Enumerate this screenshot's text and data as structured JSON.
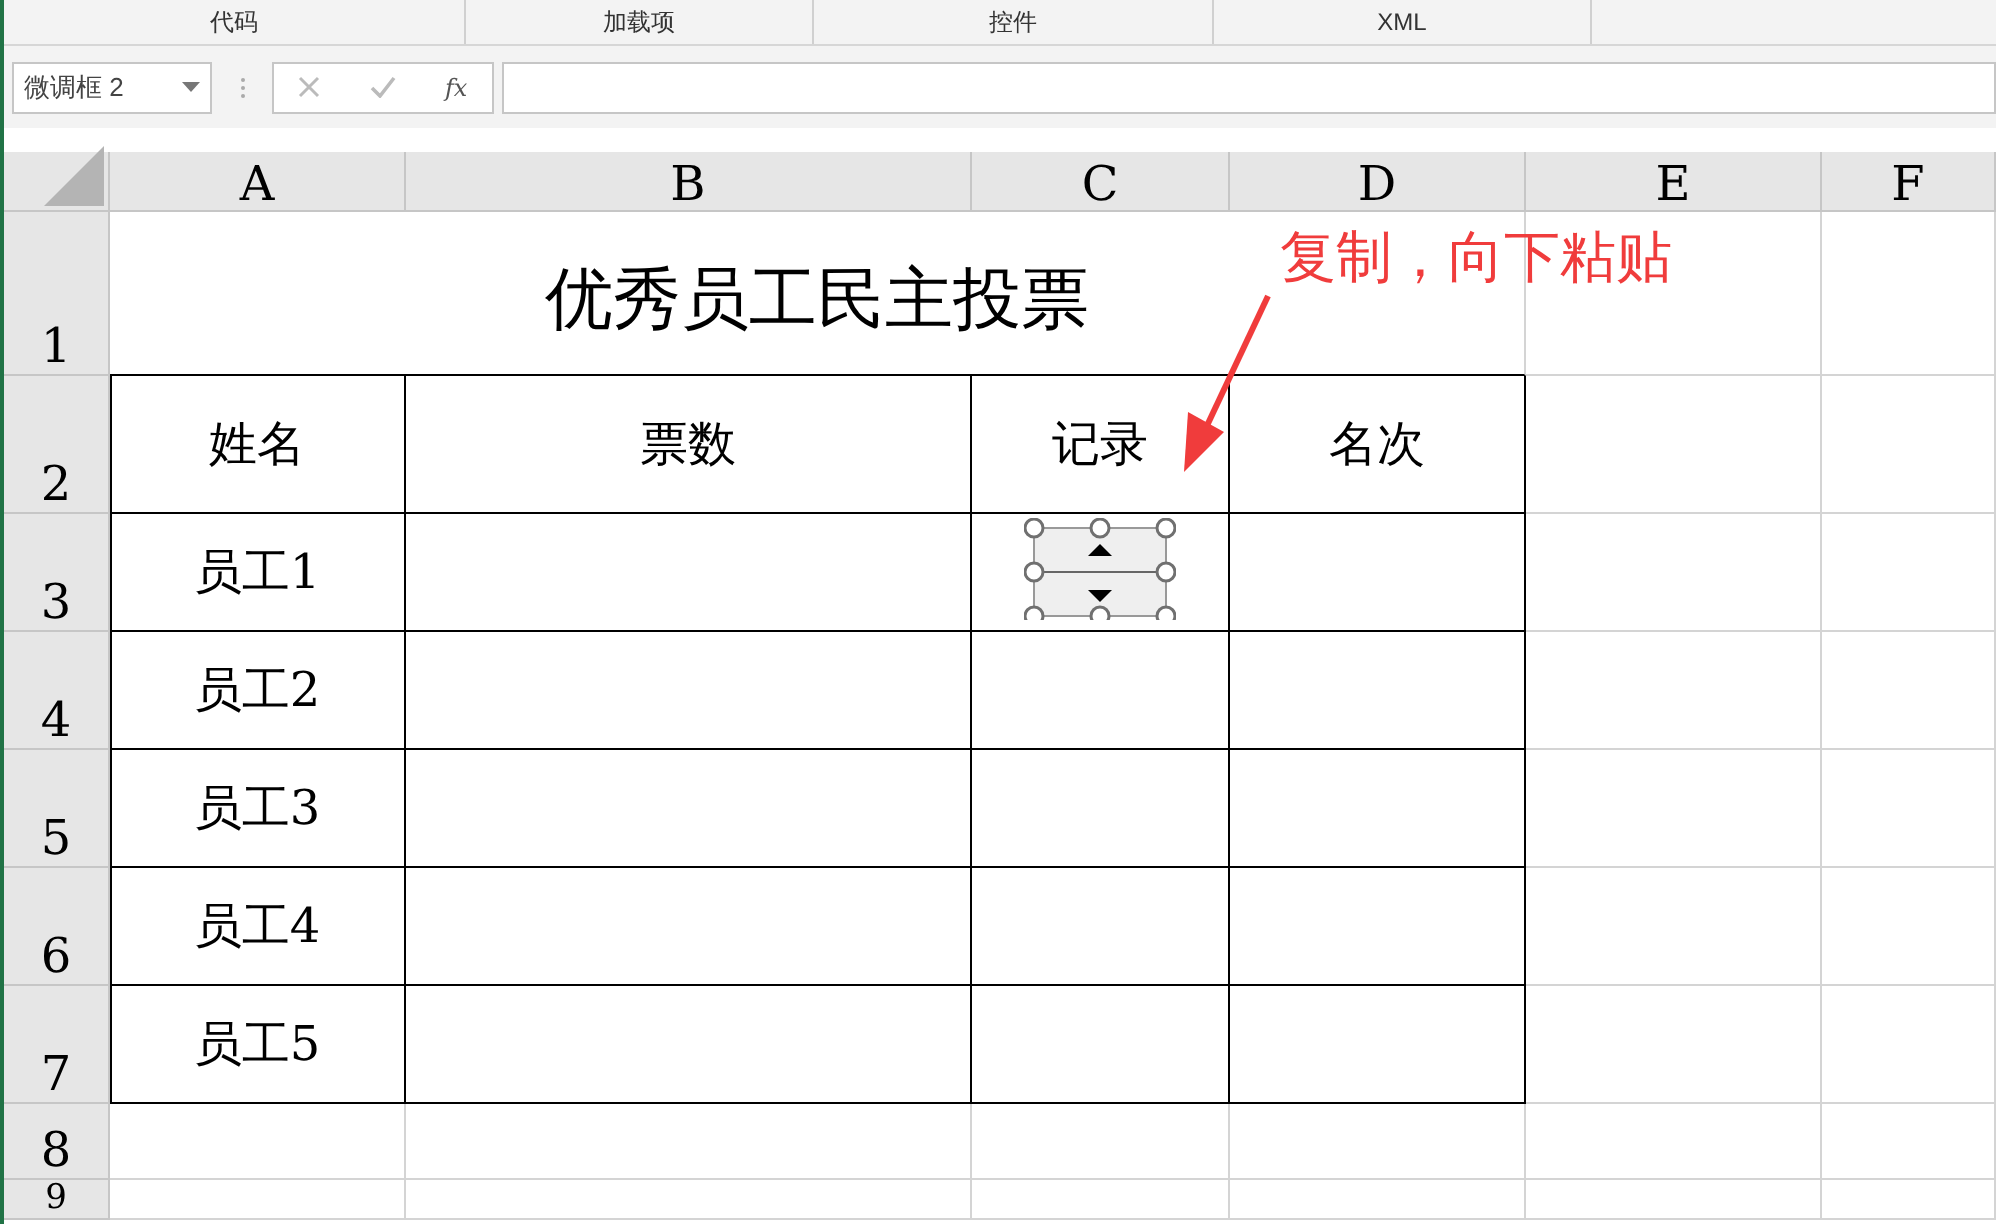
{
  "ribbon_groups": [
    "代码",
    "加载项",
    "控件",
    "XML"
  ],
  "name_box": {
    "value": "微调框 2"
  },
  "formula_bar": {
    "function_label": "fx"
  },
  "columns": [
    "A",
    "B",
    "C",
    "D",
    "E",
    "F"
  ],
  "rows": [
    "1",
    "2",
    "3",
    "4",
    "5",
    "6",
    "7",
    "8",
    "9"
  ],
  "title": "优秀员工民主投票",
  "table": {
    "headers": [
      "姓名",
      "票数",
      "记录",
      "名次"
    ],
    "names": [
      "员工1",
      "员工2",
      "员工3",
      "员工4",
      "员工5"
    ]
  },
  "spinner": {
    "selected": true
  },
  "annotation": {
    "text": "复制，向下粘贴"
  }
}
